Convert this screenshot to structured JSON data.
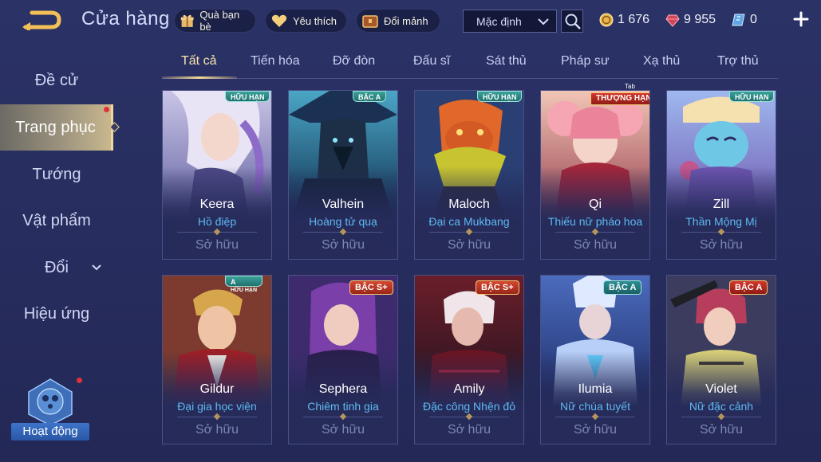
{
  "header": {
    "title": "Cửa hàng",
    "gift_label": "Quà bạn bè",
    "fav_label": "Yêu thích",
    "shard_label": "Đổi mảnh",
    "sort_value": "Mặc định",
    "gold": "1 676",
    "ruby": "9 955",
    "voucher": "0"
  },
  "sidebar": {
    "items": [
      {
        "label": "Đề cử"
      },
      {
        "label": "Trang phục"
      },
      {
        "label": "Tướng"
      },
      {
        "label": "Vật phẩm"
      },
      {
        "label": "Đổi"
      },
      {
        "label": "Hiệu ứng"
      }
    ],
    "event_label": "Hoạt động"
  },
  "tabs": [
    "Tất cả",
    "Tiến hóa",
    "Đỡ đòn",
    "Đấu sĩ",
    "Sát thủ",
    "Pháp sư",
    "Xạ thủ",
    "Trợ thủ"
  ],
  "tab_hint": "Tab",
  "cards": [
    {
      "hero": "Keera",
      "skin": "Hồ điệp",
      "status": "Sở hữu",
      "badge": "HỮU HẠN"
    },
    {
      "hero": "Valhein",
      "skin": "Hoàng tử quạ",
      "status": "Sở hữu",
      "badge": "BẬC A"
    },
    {
      "hero": "Maloch",
      "skin": "Đại ca Mukbang",
      "status": "Sở hữu",
      "badge": "HỮU HẠN"
    },
    {
      "hero": "Qi",
      "skin": "Thiếu nữ pháo hoa",
      "status": "Sở hữu",
      "badge": "THƯỢNG HẠNG"
    },
    {
      "hero": "Zill",
      "skin": "Thần Mộng Mị",
      "status": "Sở hữu",
      "badge": "HỮU HẠN"
    },
    {
      "hero": "Gildur",
      "skin": "Đại gia học viện",
      "status": "Sở hữu",
      "badge": "A",
      "badge_sub": "HỮU HẠN"
    },
    {
      "hero": "Sephera",
      "skin": "Chiêm tinh gia",
      "status": "Sở hữu",
      "badge": "BẬC S+"
    },
    {
      "hero": "Amily",
      "skin": "Đặc công Nhện đỏ",
      "status": "Sở hữu",
      "badge": "BẬC S+"
    },
    {
      "hero": "Ilumia",
      "skin": "Nữ chúa tuyết",
      "status": "Sở hữu",
      "badge": "BẬC A"
    },
    {
      "hero": "Violet",
      "skin": "Nữ đặc cảnh",
      "status": "Sở hữu",
      "badge": "BẬC A"
    }
  ],
  "colors": {
    "accent_gold": "#f0d796",
    "skin_blue": "#5fb9f0",
    "active_tab": "#f7e3b0"
  }
}
